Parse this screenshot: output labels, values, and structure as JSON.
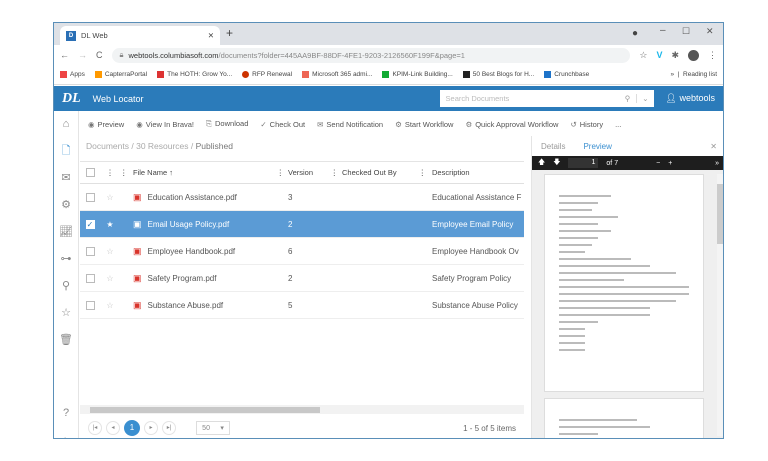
{
  "browser": {
    "tab_title": "DL Web",
    "url_host": "webtools.columbiasoft.com",
    "url_path": "/documents?folder=445AA9BF-88DF-4FE1-9203-2126560F199F&page=1",
    "bookmarks": [
      "Apps",
      "CapterraPortal",
      "The HOTH: Grow Yo...",
      "RFP Renewal",
      "Microsoft 365 admi...",
      "KPIM-Link Building...",
      "50 Best Blogs for H...",
      "Crunchbase"
    ],
    "reading_list": "Reading list"
  },
  "app": {
    "title": "Web Locator",
    "logo": "DL",
    "search_placeholder": "Search Documents",
    "user": "webtools"
  },
  "toolbar": [
    "Preview",
    "View In Brava!",
    "Download",
    "Check Out",
    "Send Notification",
    "Start Workflow",
    "Quick Approval Workflow",
    "History",
    "..."
  ],
  "breadcrumb": {
    "a": "Documents",
    "b": "30 Resources",
    "c": "Published"
  },
  "columns": {
    "file": "File Name",
    "version": "Version",
    "checked": "Checked Out By",
    "desc": "Description"
  },
  "rows": [
    {
      "name": "Education Assistance.pdf",
      "version": "3",
      "checked": "",
      "desc": "Educational Assistance F"
    },
    {
      "name": "Email Usage Policy.pdf",
      "version": "2",
      "checked": "",
      "desc": "Employee Email Policy"
    },
    {
      "name": "Employee Handbook.pdf",
      "version": "6",
      "checked": "",
      "desc": "Employee Handbook Ov"
    },
    {
      "name": "Safety Program.pdf",
      "version": "2",
      "checked": "",
      "desc": "Safety Program Policy"
    },
    {
      "name": "Substance Abuse.pdf",
      "version": "5",
      "checked": "",
      "desc": "Substance Abuse Policy"
    }
  ],
  "pager": {
    "page": "1",
    "size": "50",
    "summary": "1 - 5 of 5 items"
  },
  "panel": {
    "details": "Details",
    "preview": "Preview",
    "page": "1",
    "of": "of 7"
  }
}
